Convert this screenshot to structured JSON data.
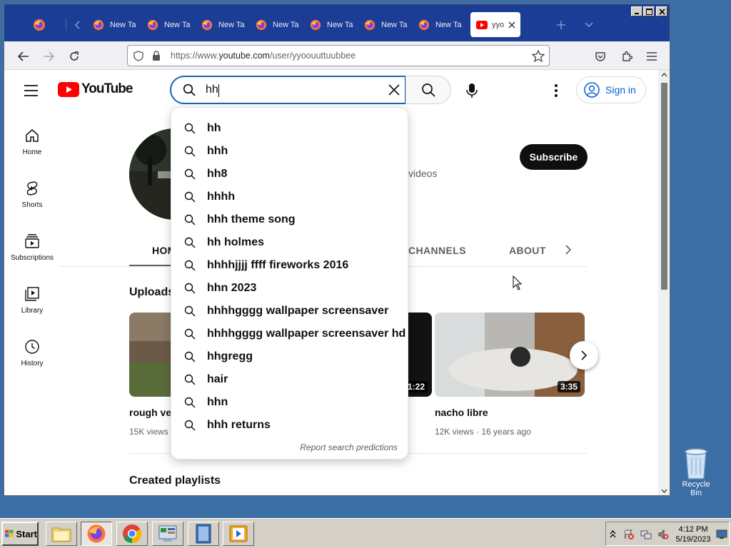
{
  "browser": {
    "tabs": [
      {
        "label": "New Ta"
      },
      {
        "label": "New Ta"
      },
      {
        "label": "New Ta"
      },
      {
        "label": "New Ta"
      },
      {
        "label": "New Ta"
      },
      {
        "label": "New Ta"
      },
      {
        "label": "New Ta"
      }
    ],
    "active_tab": {
      "label": "yyo"
    },
    "url_prefix": "https://www.",
    "url_domain": "youtube.com",
    "url_path": "/user/yyoouuttuubbee"
  },
  "youtube": {
    "logo_text": "YouTube",
    "search_value": "hh",
    "signin_label": "Sign in",
    "subscribe_label": "Subscribe",
    "channel_meta": "videos",
    "guide": [
      {
        "label": "Home"
      },
      {
        "label": "Shorts"
      },
      {
        "label": "Subscriptions"
      },
      {
        "label": "Library"
      },
      {
        "label": "History"
      }
    ],
    "channel_tabs": {
      "home": "HOM",
      "channels": "CHANNELS",
      "about": "ABOUT"
    },
    "uploads_title": "Uploads",
    "videos": [
      {
        "title": "rough ver",
        "meta": "15K views",
        "duration": ""
      },
      {
        "title": "",
        "meta": "",
        "duration": "1:22"
      },
      {
        "title": "nacho libre",
        "meta": "12K views · 16 years ago",
        "duration": "3:35"
      }
    ],
    "created_playlists": "Created playlists",
    "suggestions": [
      "hh",
      "hhh",
      "hh8",
      "hhhh",
      "hhh theme song",
      "hh holmes",
      "hhhhjjjj ffff fireworks 2016",
      "hhn 2023",
      "hhhhgggg wallpaper screensaver",
      "hhhhgggg wallpaper screensaver hd",
      "hhgregg",
      "hair",
      "hhn",
      "hhh returns"
    ],
    "report_label": "Report search predictions"
  },
  "desktop": {
    "recycle_bin": "Recycle Bin",
    "start_label": "Start",
    "clock_time": "4:12 PM",
    "clock_date": "5/19/2023"
  },
  "colors": {
    "youtube_red": "#ff0000",
    "link_blue": "#065fd4",
    "tabbar_blue": "#1c3d96",
    "desktop_blue": "#3a6ea5"
  }
}
